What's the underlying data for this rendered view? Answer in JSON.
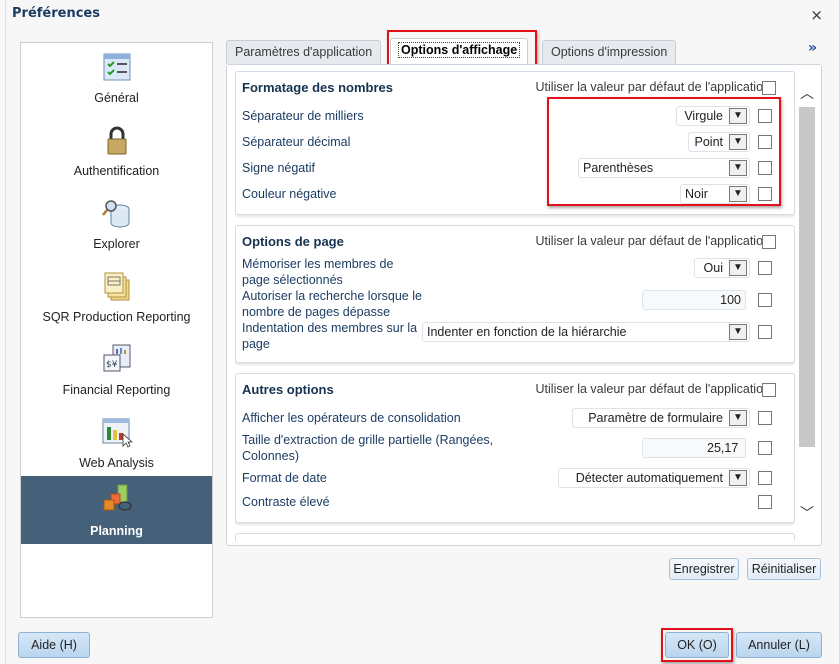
{
  "window": {
    "title": "Préférences",
    "close_label": "×"
  },
  "sidebar": {
    "items": [
      {
        "label": "Général",
        "icon": "checklist-icon",
        "active": false
      },
      {
        "label": "Authentification",
        "icon": "padlock-icon",
        "active": false
      },
      {
        "label": "Explorer",
        "icon": "database-search-icon",
        "active": false
      },
      {
        "label": "SQR Production Reporting",
        "icon": "report-pages-icon",
        "active": false
      },
      {
        "label": "Financial Reporting",
        "icon": "financial-report-icon",
        "active": false
      },
      {
        "label": "Web Analysis",
        "icon": "bar-chart-cursor-icon",
        "active": false
      },
      {
        "label": "Planning",
        "icon": "planning-blocks-icon",
        "active": true
      }
    ]
  },
  "tabs": {
    "items": [
      {
        "label": "Paramètres d'application",
        "active": false
      },
      {
        "label": "Options d'affichage",
        "active": true
      },
      {
        "label": "Options d'impression",
        "active": false
      }
    ],
    "more_label": "»"
  },
  "default_label": "Utiliser la valeur par défaut de l'application",
  "groups": {
    "number_format": {
      "title": "Formatage des nombres",
      "rows": [
        {
          "label": "Séparateur de milliers",
          "value": "Virgule",
          "checked": false
        },
        {
          "label": "Séparateur décimal",
          "value": "Point",
          "checked": false
        },
        {
          "label": "Signe négatif",
          "value": "Parenthèses",
          "checked": false
        },
        {
          "label": "Couleur négative",
          "value": "Noir",
          "checked": false
        }
      ]
    },
    "page_options": {
      "title": "Options de page",
      "rows": [
        {
          "label": "Mémoriser les membres de page sélectionnés",
          "value": "Oui",
          "checked": false
        },
        {
          "label": "Autoriser la recherche lorsque le nombre de pages dépasse",
          "value": "100",
          "checked": false
        },
        {
          "label": "Indentation des membres sur la page",
          "value": "Indenter en fonction de la hiérarchie",
          "checked": false
        }
      ]
    },
    "other_options": {
      "title": "Autres options",
      "rows": [
        {
          "label": "Afficher les opérateurs de consolidation",
          "value": "Paramètre de formulaire",
          "checked": false
        },
        {
          "label": "Taille d'extraction de grille partielle (Rangées, Colonnes)",
          "value": "25,17",
          "checked": false
        },
        {
          "label": "Format de date",
          "value": "Détecter automatiquement",
          "checked": false
        },
        {
          "label": "Contraste élevé",
          "value": "",
          "checked": false
        }
      ]
    }
  },
  "panel_buttons": {
    "save": "Enregistrer",
    "reset": "Réinitialiser"
  },
  "footer": {
    "help": "Aide (H)",
    "ok": "OK (O)",
    "cancel": "Annuler (L)"
  },
  "colors": {
    "highlight": "#e3101a",
    "active_nav": "#446179",
    "heading": "#16324f"
  }
}
